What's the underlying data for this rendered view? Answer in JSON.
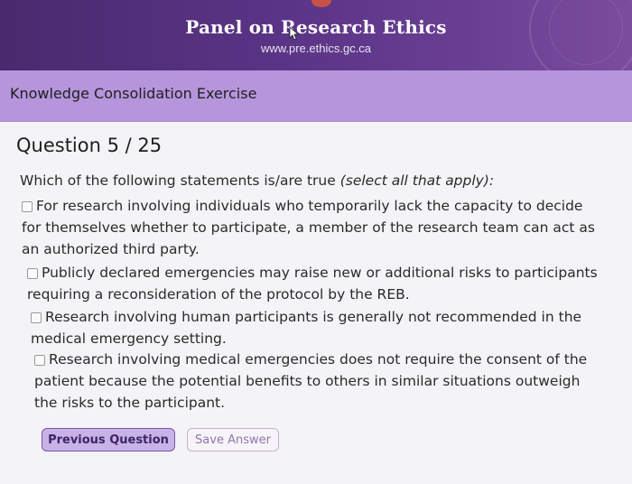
{
  "banner": {
    "title": "Panel on Research Ethics",
    "url": "www.pre.ethics.gc.ca"
  },
  "subheader": {
    "title": "Knowledge Consolidation Exercise"
  },
  "question": {
    "number_label": "Question 5 / 25",
    "prompt": "Which of the following statements is/are true ",
    "prompt_hint": "(select all that apply):",
    "options": [
      {
        "lines": [
          "For research involving individuals who temporarily lack the capacity to decide",
          "for themselves whether to participate, a member of the research team can act as",
          "an authorized third party."
        ],
        "checked": false
      },
      {
        "lines": [
          "Publicly declared emergencies may raise new or additional risks to participants",
          "requiring a reconsideration of the protocol by the REB."
        ],
        "checked": false
      },
      {
        "lines": [
          "Research involving human participants is generally not recommended in the",
          "medical emergency setting."
        ],
        "checked": false
      },
      {
        "lines": [
          "Research involving medical emergencies does not require the consent of the",
          "patient because the potential benefits to others in similar situations outweigh",
          "the risks to the participant."
        ],
        "checked": false
      }
    ]
  },
  "buttons": {
    "previous": "Previous Question",
    "save": "Save Answer"
  },
  "colors": {
    "banner": "#5a3486",
    "subheader": "#b695dc",
    "button_primary": "#c8b3e6"
  }
}
